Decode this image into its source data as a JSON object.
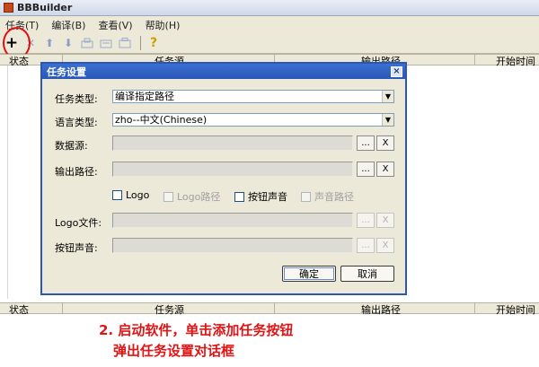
{
  "window": {
    "title": "BBBuilder"
  },
  "menu": [
    {
      "label": "任务(T)"
    },
    {
      "label": "编译(B)"
    },
    {
      "label": "查看(V)"
    },
    {
      "label": "帮助(H)"
    }
  ],
  "toolbar": {
    "add_label": "+",
    "delete_label": "✕",
    "up_label": "⬆",
    "down_label": "⬇",
    "help_label": "?"
  },
  "task_list": {
    "columns": [
      "状态",
      "任务源",
      "输出路径",
      "开始时间"
    ]
  },
  "dialog": {
    "title": "任务设置",
    "close_label": "×",
    "task_type_label": "任务类型:",
    "task_type_value": "编译指定路径",
    "language_label": "语言类型:",
    "language_value": "zho--中文(Chinese)",
    "data_source_label": "数据源:",
    "output_path_label": "输出路径:",
    "logo_check_label": "Logo",
    "logo_path_check_label": "Logo路径",
    "button_sound_check_label": "按钮声音",
    "sound_path_check_label": "声音路径",
    "logo_file_label": "Logo文件:",
    "button_sound_label": "按钮声音:",
    "browse_label": "...",
    "clear_label": "X",
    "ok_label": "确定",
    "cancel_label": "取消"
  },
  "caption": {
    "line1": "2. 启动软件，单击添加任务按钮",
    "line2": "弹出任务设置对话框"
  }
}
